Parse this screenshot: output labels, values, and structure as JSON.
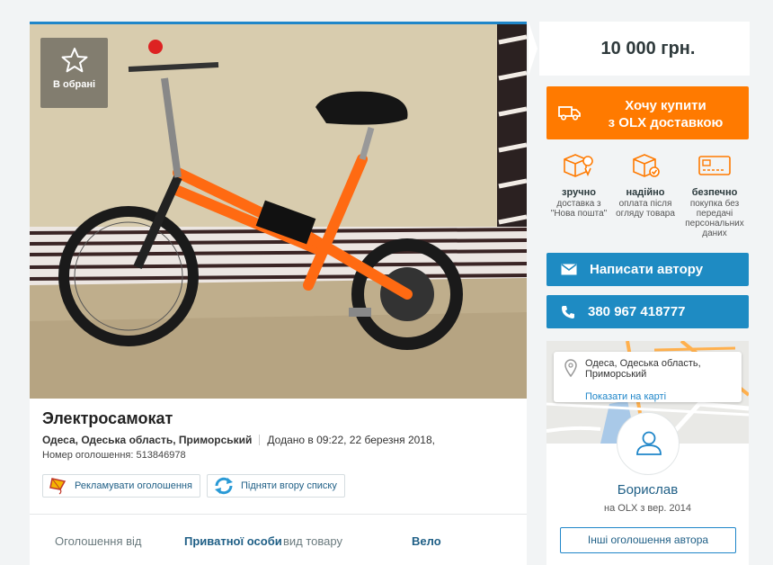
{
  "favorite": {
    "label": "В обрані"
  },
  "listing": {
    "title": "Электросамокат",
    "location": "Одеса, Одеська область, Приморський",
    "added": "Додано в 09:22, 22 березня 2018,",
    "ad_number": "Номер оголошення: 513846978"
  },
  "actions": {
    "promote_label": "Рекламувати оголошення",
    "raise_label": "Підняти вгору списку"
  },
  "details": [
    {
      "label": "Оголошення від",
      "value": "Приватної особи"
    },
    {
      "label": "вид товару",
      "value": "Вело"
    }
  ],
  "price": "10 000 грн.",
  "delivery_button": {
    "line1": "Хочу купити",
    "line2": "з OLX доставкою"
  },
  "features": [
    {
      "icon": "box-location-icon",
      "title": "зручно",
      "desc": "доставка з \"Нова пошта\""
    },
    {
      "icon": "box-check-icon",
      "title": "надійно",
      "desc": "оплата після огляду товара"
    },
    {
      "icon": "card-icon",
      "title": "безпечно",
      "desc": "покупка без передачі персональних даних"
    }
  ],
  "contact": {
    "message_label": "Написати автору",
    "phone_label": "380 967 418777"
  },
  "seller": {
    "location": "Одеса, Одеська область, Приморський",
    "map_link": "Показати на карті",
    "name": "Борислав",
    "since": "на OLX з вер. 2014",
    "other_ads_label": "Інші оголошення автора"
  },
  "colors": {
    "accent_blue": "#1e8bc3",
    "accent_orange": "#ff7a00",
    "link": "#1f5f86"
  }
}
